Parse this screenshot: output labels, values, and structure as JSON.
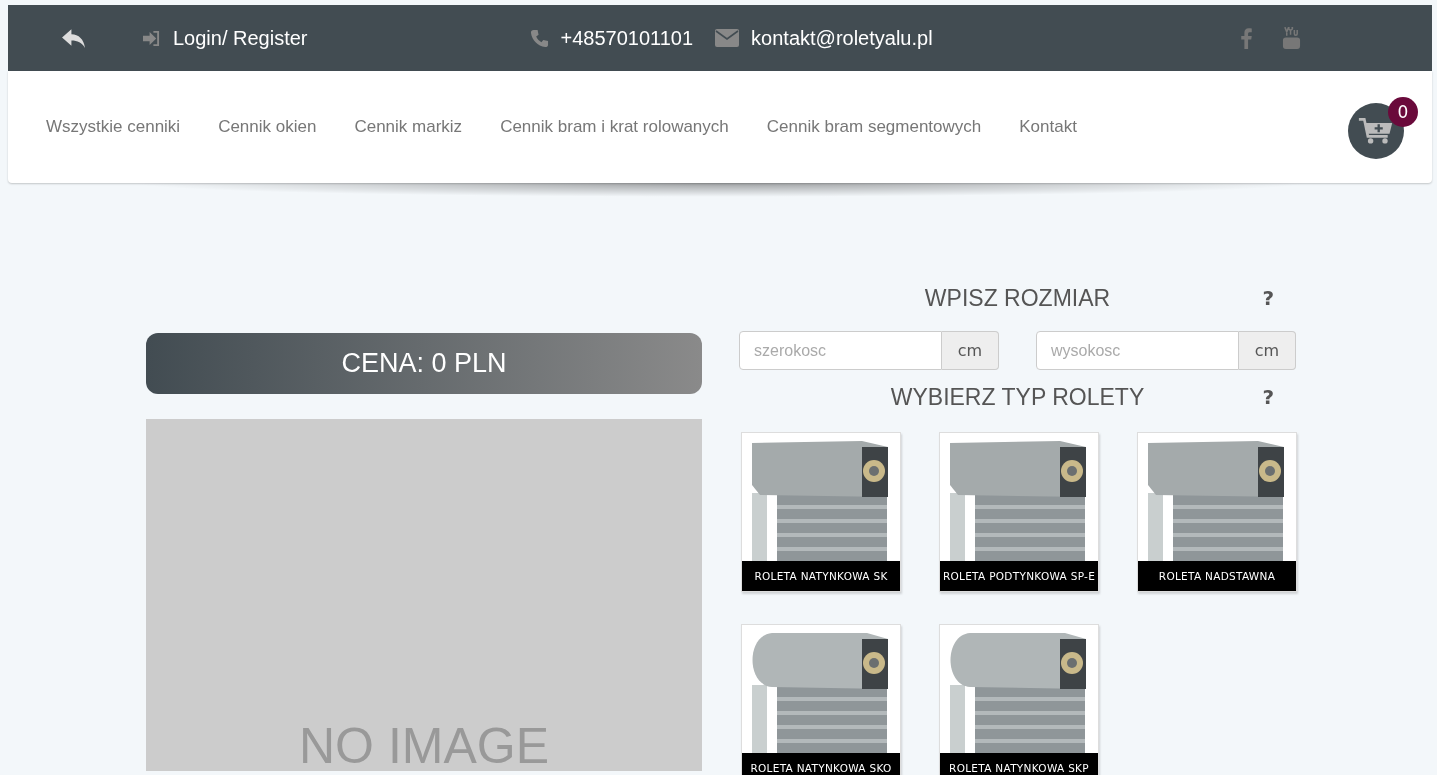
{
  "top_bar": {
    "login": "Login/ Register",
    "phone": "+48570101101",
    "email": "kontakt@roletyalu.pl"
  },
  "nav": {
    "items": [
      "Wszystkie cenniki",
      "Cennik okien",
      "Cennik markiz",
      "Cennik bram i krat rolowanych",
      "Cennik bram segmentowych",
      "Kontakt"
    ],
    "cart_count": "0"
  },
  "price": "CENA: 0 PLN",
  "preview": {
    "placeholder_text": "NO IMAGE"
  },
  "size_section": {
    "title": "WPISZ ROZMIAR",
    "help": "?",
    "fields": [
      {
        "placeholder": "szerokosc",
        "unit": "cm"
      },
      {
        "placeholder": "wysokosc",
        "unit": "cm"
      }
    ]
  },
  "type_section": {
    "title": "WYBIERZ TYP ROLETY",
    "help": "?",
    "types": [
      {
        "label": "ROLETA NATYNKOWA SK"
      },
      {
        "label": "ROLETA PODTYNKOWA SP-E"
      },
      {
        "label": "ROLETA NADSTAWNA"
      },
      {
        "label": "ROLETA NATYNKOWA SKO"
      },
      {
        "label": "ROLETA NATYNKOWA SKP"
      }
    ]
  }
}
